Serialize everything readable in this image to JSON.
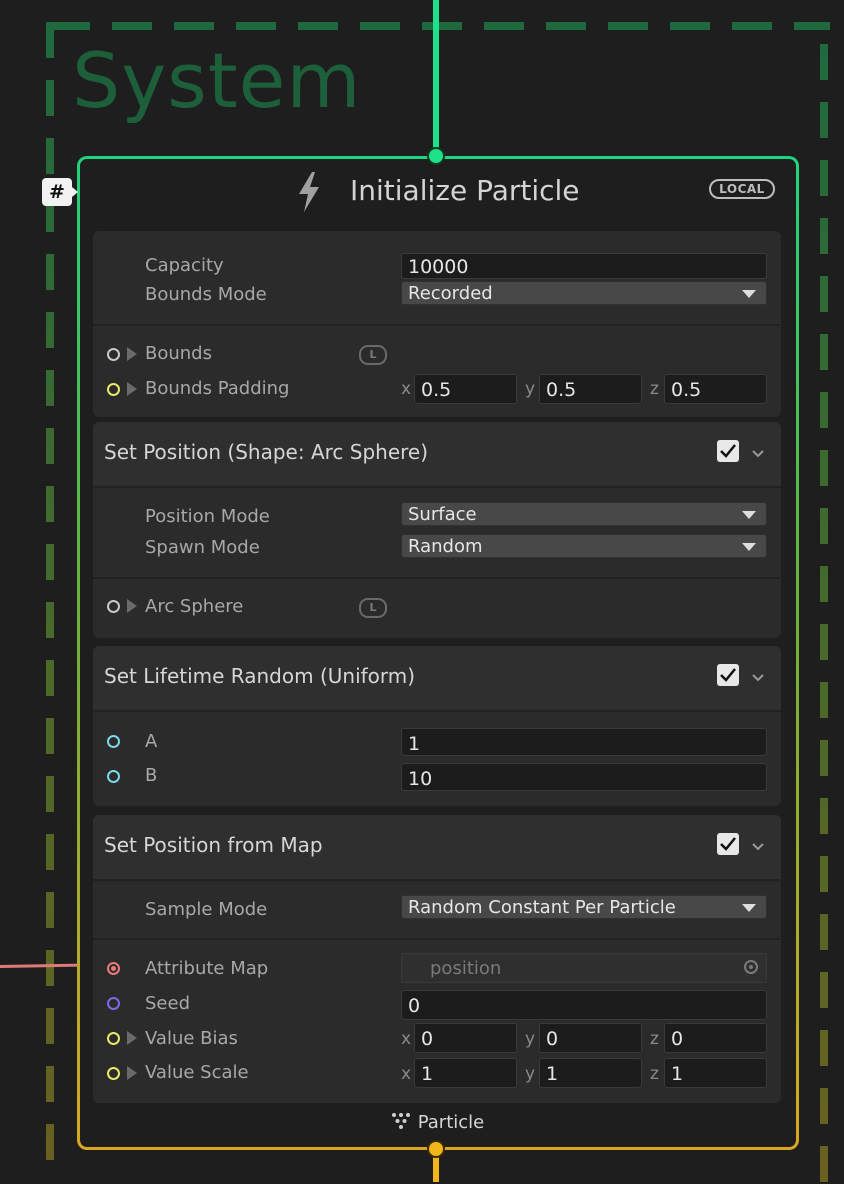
{
  "system": {
    "title": "System"
  },
  "context": {
    "title": "Initialize Particle",
    "space_badge": "LOCAL",
    "settings_badge": "#",
    "footer_label": "Particle",
    "settings": {
      "capacity_label": "Capacity",
      "capacity_value": "10000",
      "bounds_mode_label": "Bounds Mode",
      "bounds_mode_value": "Recorded",
      "bounds_label": "Bounds",
      "bounds_padding_label": "Bounds Padding",
      "bounds_padding": {
        "x": "0.5",
        "y": "0.5",
        "z": "0.5"
      },
      "space_letter": "L"
    },
    "blocks": [
      {
        "title": "Set Position (Shape: Arc Sphere)",
        "enabled": true,
        "position_mode_label": "Position Mode",
        "position_mode_value": "Surface",
        "spawn_mode_label": "Spawn Mode",
        "spawn_mode_value": "Random",
        "arc_sphere_label": "Arc Sphere",
        "space_letter": "L"
      },
      {
        "title": "Set Lifetime Random (Uniform)",
        "enabled": true,
        "a_label": "A",
        "a_value": "1",
        "b_label": "B",
        "b_value": "10"
      },
      {
        "title": "Set Position from Map",
        "enabled": true,
        "sample_mode_label": "Sample Mode",
        "sample_mode_value": "Random Constant Per Particle",
        "attribute_map_label": "Attribute Map",
        "attribute_map_value": "position",
        "seed_label": "Seed",
        "seed_value": "0",
        "value_bias_label": "Value Bias",
        "value_bias": {
          "x": "0",
          "y": "0",
          "z": "0"
        },
        "value_scale_label": "Value Scale",
        "value_scale": {
          "x": "1",
          "y": "1",
          "z": "1"
        }
      }
    ],
    "axis_labels": {
      "x": "x",
      "y": "y",
      "z": "z"
    }
  },
  "colors": {
    "flow_in": "#1de28a",
    "flow_out": "#f2b51a",
    "system_frame": "#1e6a3e",
    "port_bounds": "#c8c8c8",
    "port_vector": "#e8e86a",
    "port_float": "#7ad8e8",
    "port_texture": "#e87a7a",
    "port_uint": "#7a6ae8"
  }
}
